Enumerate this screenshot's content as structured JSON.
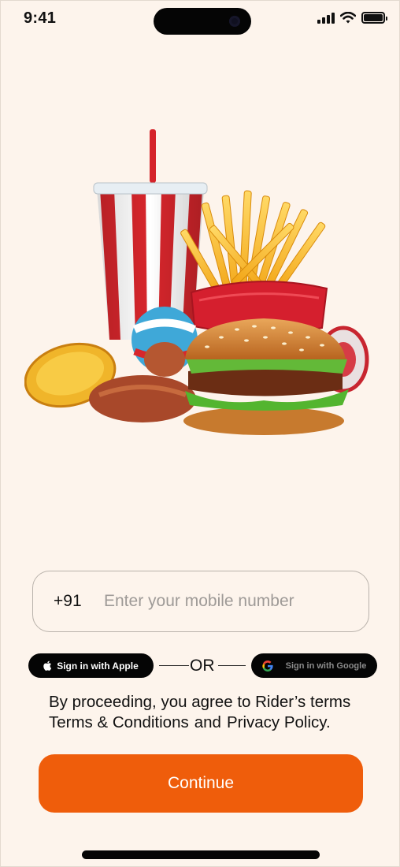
{
  "status_bar": {
    "time": "9:41",
    "icons": [
      "cellular-signal-icon",
      "wifi-icon",
      "battery-icon"
    ]
  },
  "hero": {
    "description_icon": "fast-food-illustration"
  },
  "login": {
    "country_code": "+91",
    "mobile_placeholder": "Enter your mobile number",
    "mobile_value": ""
  },
  "social": {
    "apple_label": "Sign in with Apple",
    "or_label": "OR",
    "google_label": "Sign in with Google"
  },
  "terms": {
    "line1": "By proceeding, you agree to Rider’s terms",
    "terms_link": "Terms & Conditions",
    "and_text": "and",
    "privacy_link": "Privacy Policy."
  },
  "actions": {
    "continue_label": "Continue"
  },
  "colors": {
    "background": "#fdf4ec",
    "accent": "#ef5d0b",
    "button_dark": "#050505"
  }
}
